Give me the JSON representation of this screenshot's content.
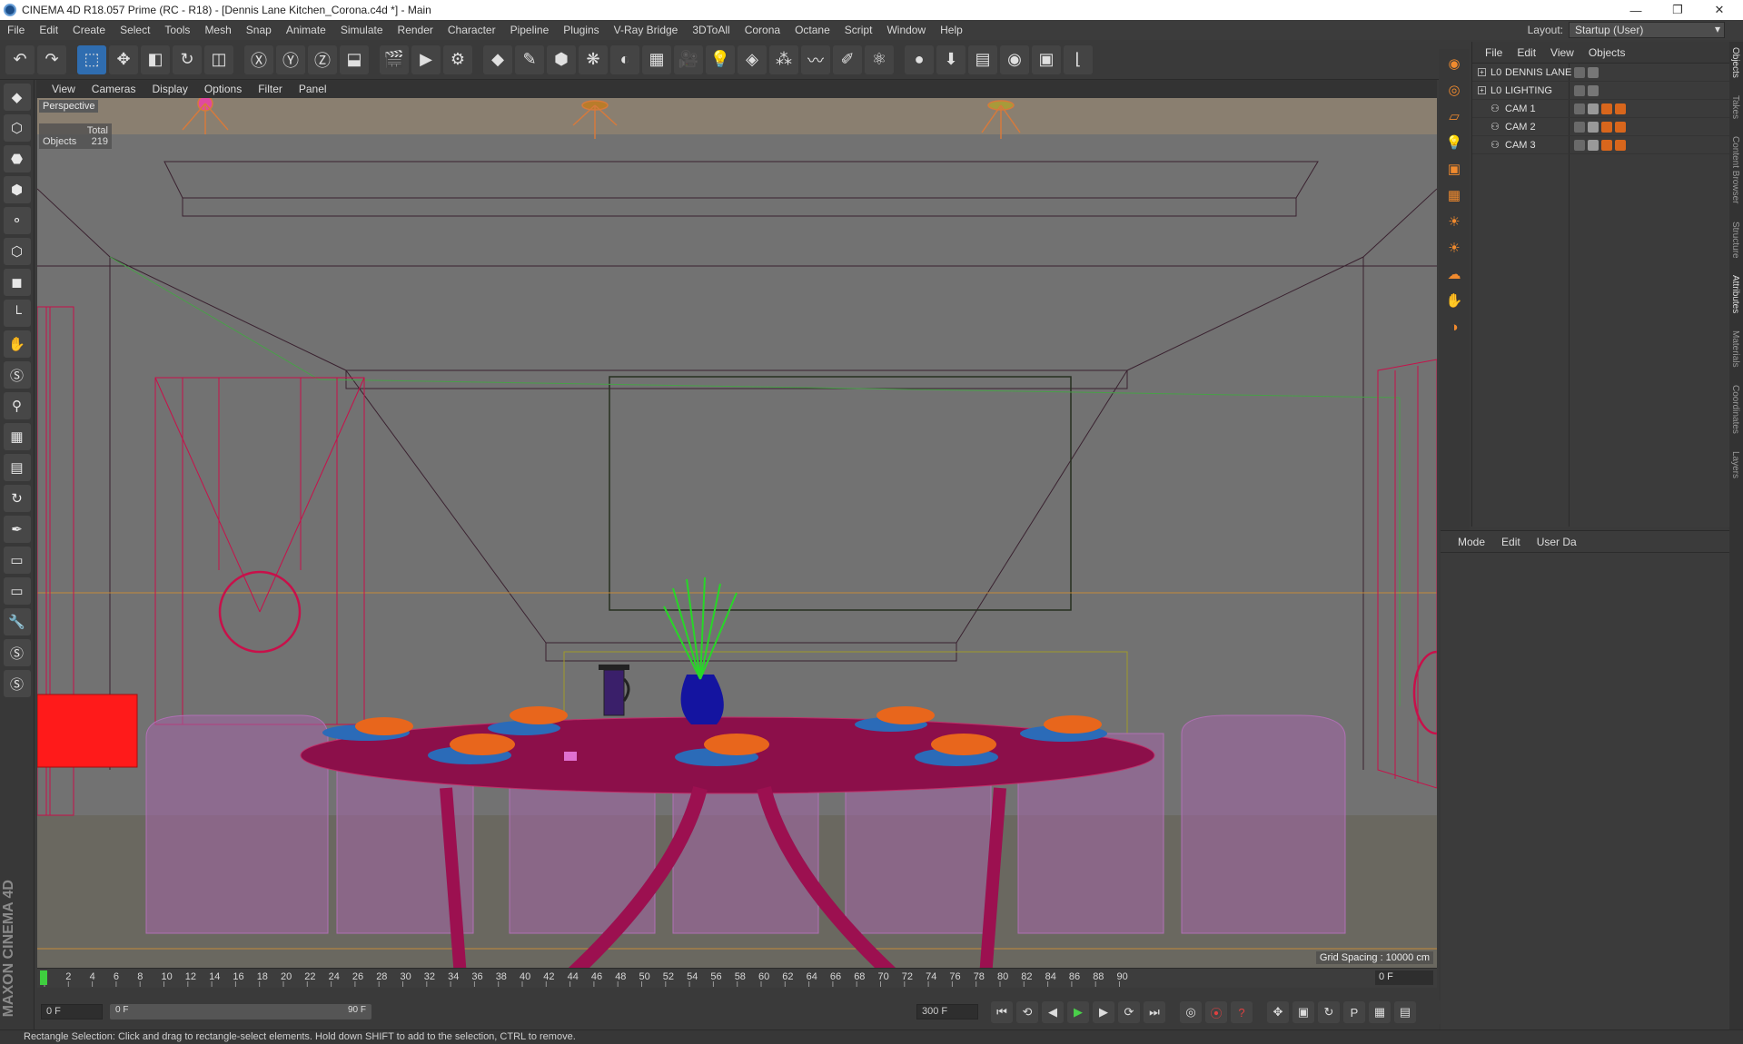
{
  "window": {
    "title": "CINEMA 4D R18.057 Prime (RC - R18) - [Dennis Lane Kitchen_Corona.c4d *] - Main",
    "minimize_glyph": "—",
    "restore_glyph": "❐",
    "close_glyph": "✕"
  },
  "menubar": {
    "items": [
      "File",
      "Edit",
      "Create",
      "Select",
      "Tools",
      "Mesh",
      "Snap",
      "Animate",
      "Simulate",
      "Render",
      "Character",
      "Pipeline",
      "Plugins",
      "V-Ray Bridge",
      "3DToAll",
      "Corona",
      "Octane",
      "Script",
      "Window",
      "Help"
    ],
    "layout_label": "Layout:",
    "layout_value": "Startup (User)"
  },
  "toolbar": {
    "icons": [
      {
        "name": "undo-icon",
        "glyph": "↶"
      },
      {
        "name": "redo-icon",
        "glyph": "↷"
      },
      {
        "name": "live-selection-icon",
        "glyph": "⬚",
        "hl": true
      },
      {
        "name": "move-icon",
        "glyph": "✥"
      },
      {
        "name": "scale-icon",
        "glyph": "◧"
      },
      {
        "name": "rotate-icon",
        "glyph": "↻"
      },
      {
        "name": "recent-tools-icon",
        "glyph": "◫"
      },
      {
        "name": "x-axis-icon",
        "glyph": "Ⓧ"
      },
      {
        "name": "y-axis-icon",
        "glyph": "Ⓨ"
      },
      {
        "name": "z-axis-icon",
        "glyph": "Ⓩ"
      },
      {
        "name": "coordinate-system-icon",
        "glyph": "⬓"
      },
      {
        "name": "render-view-icon",
        "glyph": "🎬"
      },
      {
        "name": "render-picture-viewer-icon",
        "glyph": "▶"
      },
      {
        "name": "render-settings-icon",
        "glyph": "⚙"
      },
      {
        "name": "cube-icon",
        "glyph": "◆"
      },
      {
        "name": "pen-spline-icon",
        "glyph": "✎"
      },
      {
        "name": "subdivision-icon",
        "glyph": "⬢"
      },
      {
        "name": "array-icon",
        "glyph": "❋"
      },
      {
        "name": "deformer-icon",
        "glyph": "◐"
      },
      {
        "name": "floor-icon",
        "glyph": "▦"
      },
      {
        "name": "camera-icon",
        "glyph": "🎥"
      },
      {
        "name": "light-icon",
        "glyph": "💡"
      },
      {
        "name": "tag-icon",
        "glyph": "◈"
      },
      {
        "name": "mograph-icon",
        "glyph": "⁂"
      },
      {
        "name": "hair-icon",
        "glyph": "〰"
      },
      {
        "name": "sketch-icon",
        "glyph": "✐"
      },
      {
        "name": "xpresso-icon",
        "glyph": "⚛"
      },
      {
        "name": "corona-material-icon",
        "glyph": "●"
      },
      {
        "name": "corona-render-icon",
        "glyph": "⬇"
      },
      {
        "name": "corona-settings-icon",
        "glyph": "▤"
      },
      {
        "name": "color-picker-icon",
        "glyph": "◉"
      },
      {
        "name": "interactive-render-icon",
        "glyph": "▣"
      },
      {
        "name": "snap-icon",
        "glyph": "⌊"
      }
    ]
  },
  "left_tools": {
    "icons": [
      "model-mode-icon",
      "object-mode-icon",
      "texture-mode-icon",
      "workplane-icon",
      "points-mode-icon",
      "edges-mode-icon",
      "polygons-mode-icon",
      "axis-mode-icon",
      "tweak-mode-icon",
      "soft-selection-icon",
      "magnet-icon",
      "locked-workplane-icon",
      "planar-workplane-icon",
      "sculpt-icon",
      "paint-icon",
      "uv-icon",
      "uv-edit-icon",
      "wrench-icon",
      "snap-settings-icon",
      "quantize-icon"
    ],
    "glyphs": [
      "◆",
      "⬡",
      "⬣",
      "⬢",
      "⚬",
      "⬡",
      "◼",
      "└",
      "✋",
      "Ⓢ",
      "⚲",
      "▦",
      "▤",
      "↻",
      "✒",
      "▭",
      "▭",
      "🔧",
      "Ⓢ",
      "Ⓢ"
    ],
    "brand": "MAXON CINEMA 4D"
  },
  "viewport": {
    "menu": [
      "View",
      "Cameras",
      "Display",
      "Options",
      "Filter",
      "Panel"
    ],
    "label": "Perspective",
    "hud_header": "Total",
    "hud_row_label": "Objects",
    "hud_row_value": "219",
    "grid_spacing": "Grid Spacing : 10000 cm"
  },
  "timeline": {
    "ticks": [
      "0",
      "2",
      "4",
      "6",
      "8",
      "10",
      "12",
      "14",
      "16",
      "18",
      "20",
      "22",
      "24",
      "26",
      "28",
      "30",
      "32",
      "34",
      "36",
      "38",
      "40",
      "42",
      "44",
      "46",
      "48",
      "50",
      "52",
      "54",
      "56",
      "58",
      "60",
      "62",
      "64",
      "66",
      "68",
      "70",
      "72",
      "74",
      "76",
      "78",
      "80",
      "82",
      "84",
      "86",
      "88",
      "90"
    ],
    "current_frame": "0 F"
  },
  "transport": {
    "start": "0 F",
    "slider_start": "0 F",
    "slider_end": "90 F",
    "end": "300 F"
  },
  "object_manager": {
    "menu": [
      "File",
      "Edit",
      "View",
      "Objects"
    ],
    "rows": [
      {
        "name": "DENNIS LANE",
        "kind": "layer",
        "icon": "L0",
        "expand": "+"
      },
      {
        "name": "LIGHTING",
        "kind": "layer",
        "icon": "L0",
        "expand": "+"
      },
      {
        "name": "CAM 1",
        "kind": "camera",
        "icon": "⚇",
        "expand": ""
      },
      {
        "name": "CAM 2",
        "kind": "camera",
        "icon": "⚇",
        "expand": ""
      },
      {
        "name": "CAM 3",
        "kind": "camera",
        "icon": "⚇",
        "expand": ""
      }
    ]
  },
  "attributes": {
    "menu": [
      "Mode",
      "Edit",
      "User Da"
    ]
  },
  "side_tabs": [
    "Objects",
    "Takes",
    "Content Browser",
    "Structure",
    "Attributes",
    "Materials",
    "Coordinates",
    "Layers"
  ],
  "status": "Rectangle Selection: Click and drag to rectangle-select elements. Hold down SHIFT to add to the selection, CTRL to remove.",
  "colors": {
    "accent": "#2f6db0",
    "wireframe_red": "#c8104a",
    "chair_violet": "#a466a8",
    "table_magenta": "#8c0f4a",
    "highlight_red": "#ff1a1a",
    "bowl_orange": "#e8661c"
  }
}
